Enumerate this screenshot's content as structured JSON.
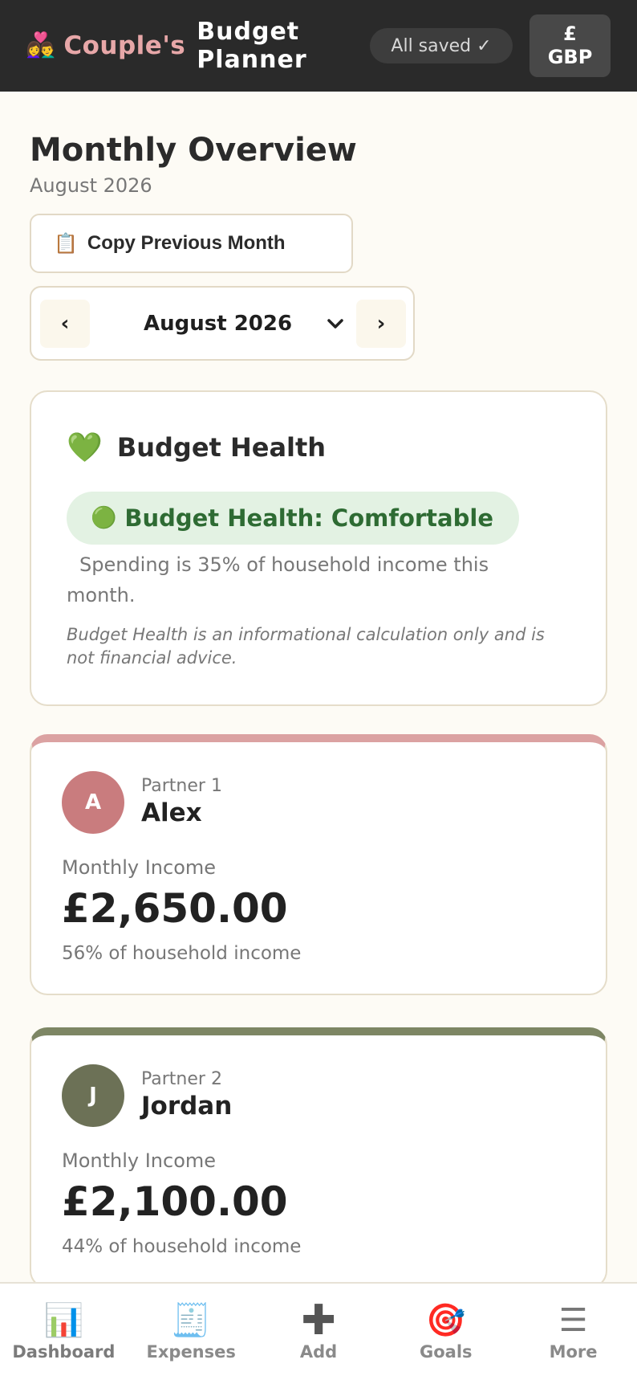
{
  "header": {
    "brand_icon": "👩‍❤️‍👨",
    "brand_pink": "Couple's",
    "brand_line1": "Budget",
    "brand_line2": "Planner",
    "saved_status": "All saved ✓",
    "currency_symbol": "£",
    "currency_code": "GBP"
  },
  "overview": {
    "title": "Monthly Overview",
    "subtitle": "August 2026",
    "copy_button_icon": "📋",
    "copy_button_label": "Copy Previous Month",
    "month_prev": "‹",
    "month_next": "›",
    "selected_month": "August 2026",
    "month_chevron": "⌄"
  },
  "health": {
    "icon": "💚",
    "title": "Budget Health",
    "badge_dot": "🟢",
    "badge_label": "Budget Health: Comfortable",
    "description": "Spending is 35% of household income this month.",
    "disclaimer": "Budget Health is an informational calculation only and is not financial advice."
  },
  "partners": [
    {
      "initial": "A",
      "role": "Partner 1",
      "name": "Alex",
      "income_label": "Monthly Income",
      "income": "£2,650.00",
      "share": "56% of household income",
      "accent": "#dba2a2"
    },
    {
      "initial": "J",
      "role": "Partner 2",
      "name": "Jordan",
      "income_label": "Monthly Income",
      "income": "£2,100.00",
      "share": "44% of household income",
      "accent": "#7d8664"
    }
  ],
  "bottom_nav": [
    {
      "icon": "📊",
      "label": "Dashboard",
      "icon_name": "bar-chart-icon"
    },
    {
      "icon": "🧾",
      "label": "Expenses",
      "icon_name": "receipt-icon"
    },
    {
      "icon": "✚",
      "label": "Add",
      "icon_name": "plus-icon"
    },
    {
      "icon": "🎯",
      "label": "Goals",
      "icon_name": "target-icon"
    },
    {
      "icon": "☰",
      "label": "More",
      "icon_name": "menu-icon"
    }
  ]
}
